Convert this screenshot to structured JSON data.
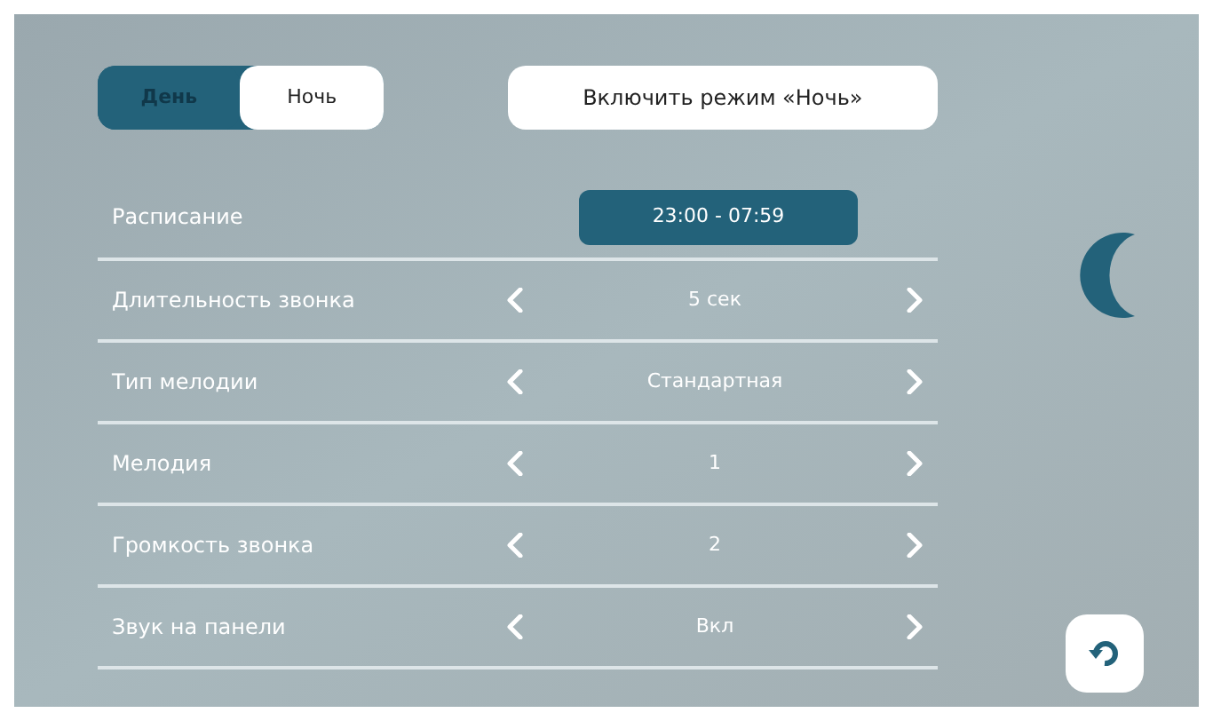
{
  "mode_tabs": [
    {
      "label": "День",
      "selected": true
    },
    {
      "label": "Ночь",
      "selected": false
    }
  ],
  "switch_button": "Включить режим «Ночь»",
  "settings": [
    {
      "kind": "time",
      "label": "Расписание",
      "value": "23:00 - 07:59"
    },
    {
      "kind": "stepper",
      "label": "Длительность звонка",
      "value": "5 сек"
    },
    {
      "kind": "stepper",
      "label": "Тип мелодии",
      "value": "Стандартная"
    },
    {
      "kind": "stepper",
      "label": "Мелодия",
      "value": "1"
    },
    {
      "kind": "stepper",
      "label": "Громкость звонка",
      "value": "2"
    },
    {
      "kind": "stepper",
      "label": "Звук на панели",
      "value": "Вкл"
    }
  ]
}
